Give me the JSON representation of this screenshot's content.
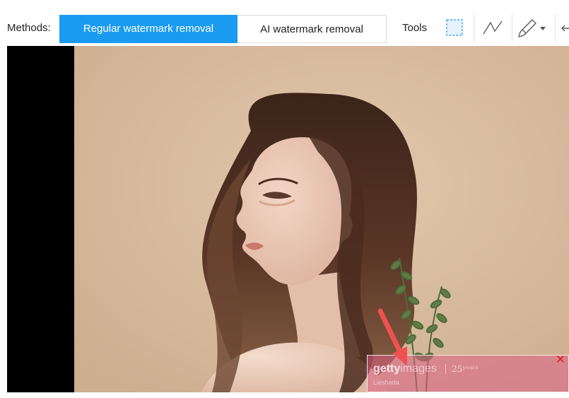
{
  "toolbar": {
    "methods_label": "Methods:",
    "regular_removal": "Regular watermark removal",
    "ai_removal": "AI watermark removal",
    "tools_label": "Tools",
    "tools": [
      {
        "name": "rectangle-select-icon"
      },
      {
        "name": "polyline-icon"
      },
      {
        "name": "brush-icon"
      },
      {
        "name": "chevron-down-icon"
      },
      {
        "name": "undo-icon"
      }
    ]
  },
  "watermark": {
    "brand_bold": "getty",
    "brand_light": "images",
    "years": "25ʸᵉᵃʳˢ",
    "credit": "Liesbada",
    "close_symbol": "✕"
  },
  "colors": {
    "accent": "#1a9bf0",
    "watermark_fill": "#dc5f87",
    "arrow": "#f05050",
    "close": "#e02020"
  }
}
